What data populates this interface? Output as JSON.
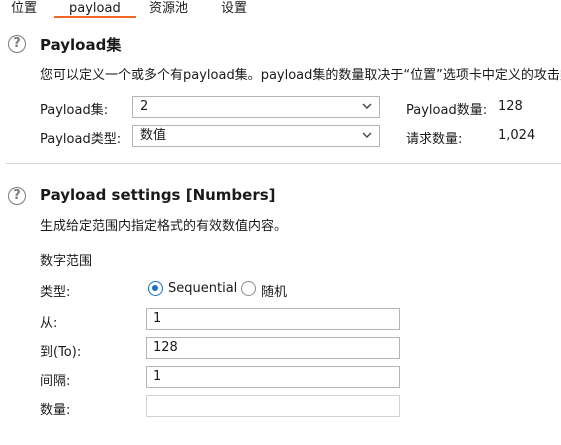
{
  "tabs": [
    {
      "label": "位置",
      "active": false
    },
    {
      "label": "payload",
      "active": true
    },
    {
      "label": "资源池",
      "active": false
    },
    {
      "label": "设置",
      "active": false
    }
  ],
  "accent_color": "#f26a21",
  "payload_sets": {
    "title": "Payload集",
    "description": "您可以定义一个或多个有payload集。payload集的数量取决于“位置”选项卡中定义的攻击类",
    "set_label": "Payload集:",
    "set_value": "2",
    "type_label": "Payload类型:",
    "type_value": "数值",
    "count_label": "Payload数量:",
    "count_value": "128",
    "requests_label": "请求数量:",
    "requests_value": "1,024"
  },
  "payload_settings": {
    "title": "Payload settings [Numbers]",
    "description": "生成给定范围内指定格式的有效数值内容。",
    "range_heading": "数字范围",
    "type_label": "类型:",
    "option_sequential": "Sequential",
    "option_random": "随机",
    "selected_option": "Sequential",
    "from_label": "从:",
    "from_value": "1",
    "to_label": "到(To):",
    "to_value": "128",
    "step_label": "间隔:",
    "step_value": "1",
    "howmany_label": "数量:",
    "howmany_value": ""
  },
  "icons": {
    "help": "help-circle-icon",
    "dropdown": "chevron-down-icon"
  }
}
